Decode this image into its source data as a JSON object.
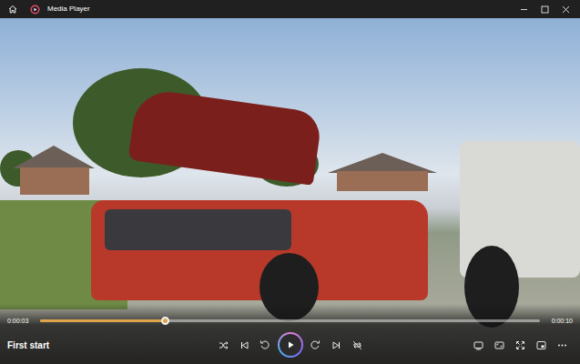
{
  "window": {
    "title": "Media Player"
  },
  "player": {
    "elapsed": "0:00:03",
    "duration": "0:00:10",
    "level": 0.25,
    "title": "First start",
    "playing": false
  }
}
